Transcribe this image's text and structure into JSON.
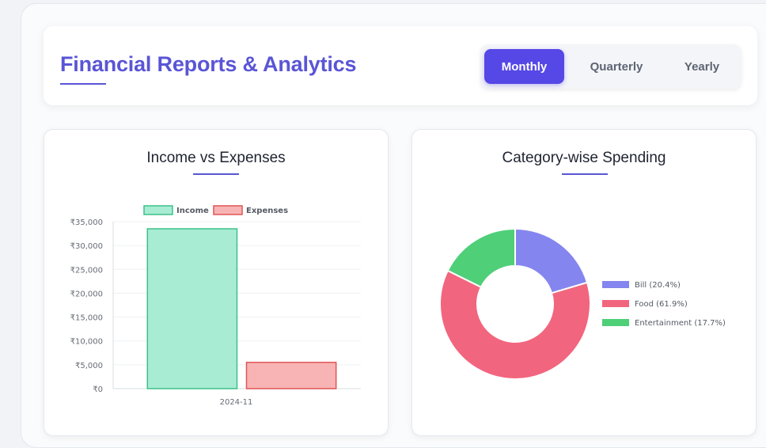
{
  "header": {
    "title": "Financial Reports & Analytics",
    "tabs": [
      {
        "label": "Monthly",
        "active": true
      },
      {
        "label": "Quarterly",
        "active": false
      },
      {
        "label": "Yearly",
        "active": false
      }
    ]
  },
  "colors": {
    "accent": "#5648e6",
    "title": "#5a55d6",
    "income_fill": "#a8ecd3",
    "income_stroke": "#3cc18a",
    "expenses_fill": "#f8b4b4",
    "expenses_stroke": "#e05555",
    "bill": "#8585ef",
    "food": "#f2657e",
    "entertainment": "#4fcf78"
  },
  "income_chart": {
    "title": "Income vs Expenses"
  },
  "spending_chart": {
    "title": "Category-wise Spending"
  },
  "chart_data": [
    {
      "type": "bar",
      "title": "Income vs Expenses",
      "categories": [
        "2024-11"
      ],
      "series": [
        {
          "name": "Income",
          "values": [
            33500
          ]
        },
        {
          "name": "Expenses",
          "values": [
            5500
          ]
        }
      ],
      "ylim": [
        0,
        35000
      ],
      "yticks": [
        "₹0",
        "₹5,000",
        "₹10,000",
        "₹15,000",
        "₹20,000",
        "₹25,000",
        "₹30,000",
        "₹35,000"
      ],
      "legend": "top",
      "grid": true
    },
    {
      "type": "pie",
      "variant": "doughnut",
      "title": "Category-wise Spending",
      "slices": [
        {
          "label": "Bill (20.4%)",
          "value": 20.4
        },
        {
          "label": "Food (61.9%)",
          "value": 61.9
        },
        {
          "label": "Entertainment (17.7%)",
          "value": 17.7
        }
      ],
      "legend": "right"
    }
  ]
}
